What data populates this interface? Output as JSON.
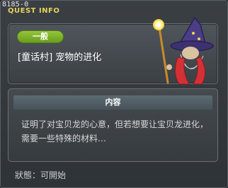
{
  "window": {
    "id": "8185-0",
    "title": "QUEST INFO"
  },
  "quest": {
    "category": "一般",
    "name": "[童话村] 宠物的进化"
  },
  "npc": {
    "icon": "wizard-npc-icon"
  },
  "content": {
    "header": "内容",
    "lines": [
      "证明了对宝贝龙的心意，但若想要让宝贝龙进化，",
      "需要一些特殊的材料…"
    ]
  },
  "status": {
    "text": "狀態：可開始"
  },
  "colors": {
    "title": "#e8d25a",
    "badge": "#7fb02a",
    "accent_header": "#52606a"
  }
}
